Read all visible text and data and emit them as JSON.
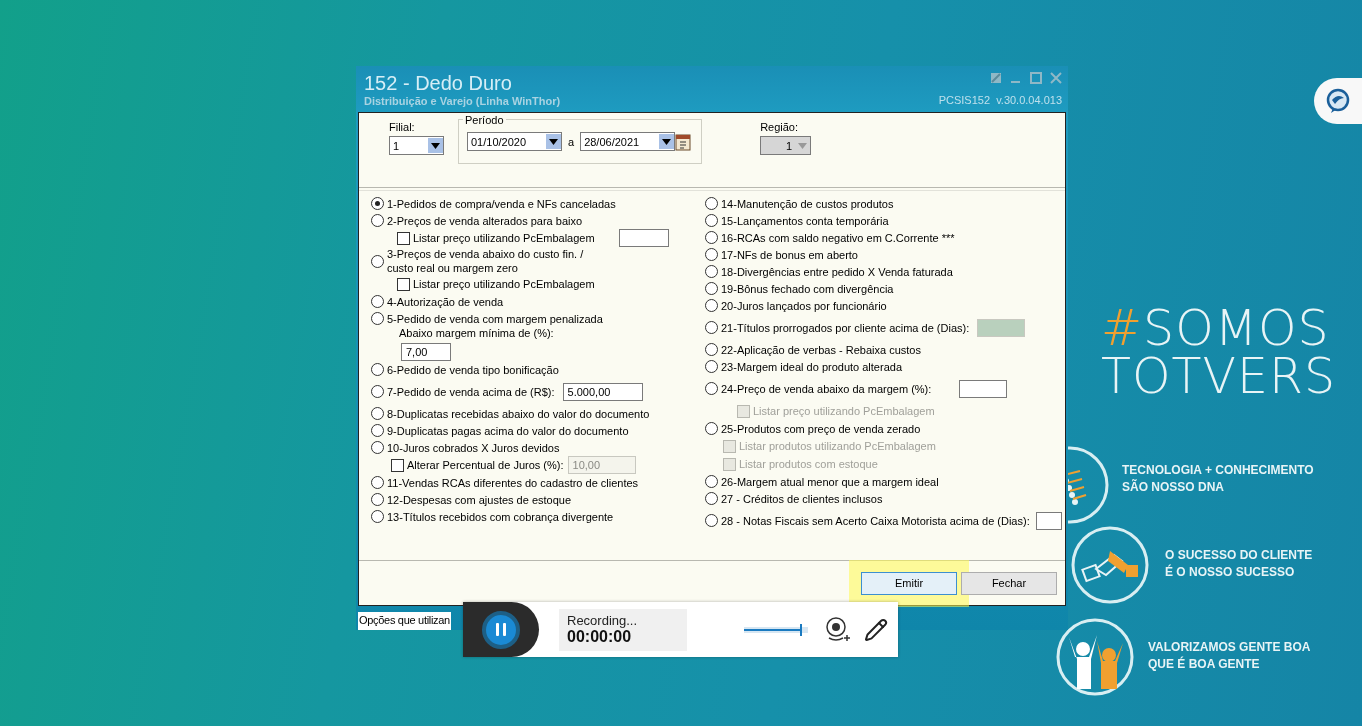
{
  "window": {
    "title": "152 - Dedo Duro",
    "subtitle": "Distribuição e Varejo (Linha WinThor)",
    "version": "PCSIS152  v.30.0.04.013"
  },
  "filter": {
    "filial": {
      "label": "Filial:",
      "value": "1"
    },
    "periodo": {
      "label": "Período",
      "start": "01/10/2020",
      "separator": "a",
      "end": "28/06/2021"
    },
    "regiao": {
      "label": "Região:",
      "value": "1",
      "disabled": true
    }
  },
  "options_left": [
    {
      "label": "1-Pedidos de compra/venda e NFs canceladas",
      "selected": true
    },
    {
      "label": "2-Preços de venda alterados para baixo",
      "selected": false,
      "extras": [
        {
          "kind": "checkbox",
          "label": "Listar preço utilizando PcEmbalagem",
          "checked": false,
          "disabled": false,
          "field": {
            "disabled": false
          }
        }
      ]
    },
    {
      "label": "3-Preços de venda abaixo do custo fin. /\ncusto real ou margem zero",
      "selected": false,
      "extras": [
        {
          "kind": "checkbox",
          "label": "Listar preço utilizando PcEmbalagem",
          "checked": false,
          "disabled": false
        }
      ]
    },
    {
      "label": "4-Autorização de venda",
      "selected": false
    },
    {
      "label": "5-Pedido de venda com margem penalizada",
      "selected": false,
      "extras": [
        {
          "kind": "text",
          "text": "Abaixo margem mínima de (%):"
        },
        {
          "kind": "field",
          "value": "7,00",
          "disabled": false
        }
      ]
    },
    {
      "label": "6-Pedido de venda tipo bonificação",
      "selected": false
    },
    {
      "label": "7-Pedido de venda acima de (R$):",
      "selected": false,
      "field": {
        "value": "5.000,00",
        "disabled": false
      }
    },
    {
      "label": "8-Duplicatas recebidas abaixo do valor do documento",
      "selected": false
    },
    {
      "label": "9-Duplicatas pagas acima do valor do documento",
      "selected": false
    },
    {
      "label": "10-Juros cobrados X Juros devidos",
      "selected": false,
      "extras": [
        {
          "kind": "checkbox",
          "label": "Alterar Percentual de Juros (%):",
          "checked": false,
          "disabled": false,
          "field": {
            "value": "10,00",
            "disabled": true
          }
        }
      ]
    },
    {
      "label": "11-Vendas RCAs diferentes do cadastro de clientes",
      "selected": false
    },
    {
      "label": "12-Despesas com ajustes de estoque",
      "selected": false
    },
    {
      "label": "13-Títulos recebidos com cobrança divergente",
      "selected": false
    }
  ],
  "options_right": [
    {
      "label": "14-Manutenção de custos produtos",
      "selected": false
    },
    {
      "label": "15-Lançamentos conta temporária",
      "selected": false
    },
    {
      "label": "16-RCAs com saldo negativo em C.Corrente ***",
      "selected": false
    },
    {
      "label": "17-NFs de bonus em aberto",
      "selected": false
    },
    {
      "label": "18-Divergências entre pedido X Venda faturada",
      "selected": false
    },
    {
      "label": "19-Bônus fechado com divergência",
      "selected": false
    },
    {
      "label": "20-Juros lançados por funcionário",
      "selected": false
    },
    {
      "label": "21-Títulos prorrogados por cliente acima de (Dias):",
      "selected": false,
      "field": {
        "disabled": true
      }
    },
    {
      "label": "22-Aplicação de verbas - Rebaixa custos",
      "selected": false
    },
    {
      "label": "23-Margem ideal do produto alterada",
      "selected": false
    },
    {
      "label": "24-Preço de venda abaixo da margem (%):",
      "selected": false,
      "field": {
        "disabled": false
      },
      "extras": [
        {
          "kind": "checkbox",
          "label": "Listar preço utilizando PcEmbalagem",
          "checked": false,
          "disabled": true
        }
      ]
    },
    {
      "label": "25-Produtos com preço de venda zerado",
      "selected": false,
      "extras": [
        {
          "kind": "checkbox",
          "label": "Listar produtos utilizando PcEmbalagem",
          "checked": false,
          "disabled": true
        },
        {
          "kind": "checkbox",
          "label": "Listar produtos com estoque",
          "checked": false,
          "disabled": true
        }
      ]
    },
    {
      "label": "26-Margem atual menor que a margem ideal",
      "selected": false
    },
    {
      "label": "27 - Créditos de clientes inclusos",
      "selected": false
    },
    {
      "label": "28 - Notas Fiscais sem Acerto Caixa Motorista acima de (Dias):",
      "selected": false,
      "field": {
        "disabled": false
      }
    }
  ],
  "buttons": [
    {
      "label": "Emitir",
      "highlighted": true
    },
    {
      "label": "Fechar",
      "highlighted": false
    }
  ],
  "status_bar": "Opções que utilizan",
  "recorder": {
    "status": "Recording...",
    "time": "00:00:00",
    "volume": {
      "level": 0.9
    }
  },
  "promo": {
    "title": [
      {
        "prefix": "#",
        "text": "SOMOS"
      },
      {
        "text": "TOTVERS"
      }
    ],
    "values": [
      {
        "kind": "dna",
        "text": "TECNOLOGIA + CONHECIMENTO\nSÃO NOSSO DNA"
      },
      {
        "kind": "handshake",
        "text": "O SUCESSO DO CLIENTE\nÉ O NOSSO SUCESSO"
      },
      {
        "kind": "people",
        "text": "VALORIZAMOS GENTE BOA\nQUE É BOA GENTE"
      }
    ]
  }
}
